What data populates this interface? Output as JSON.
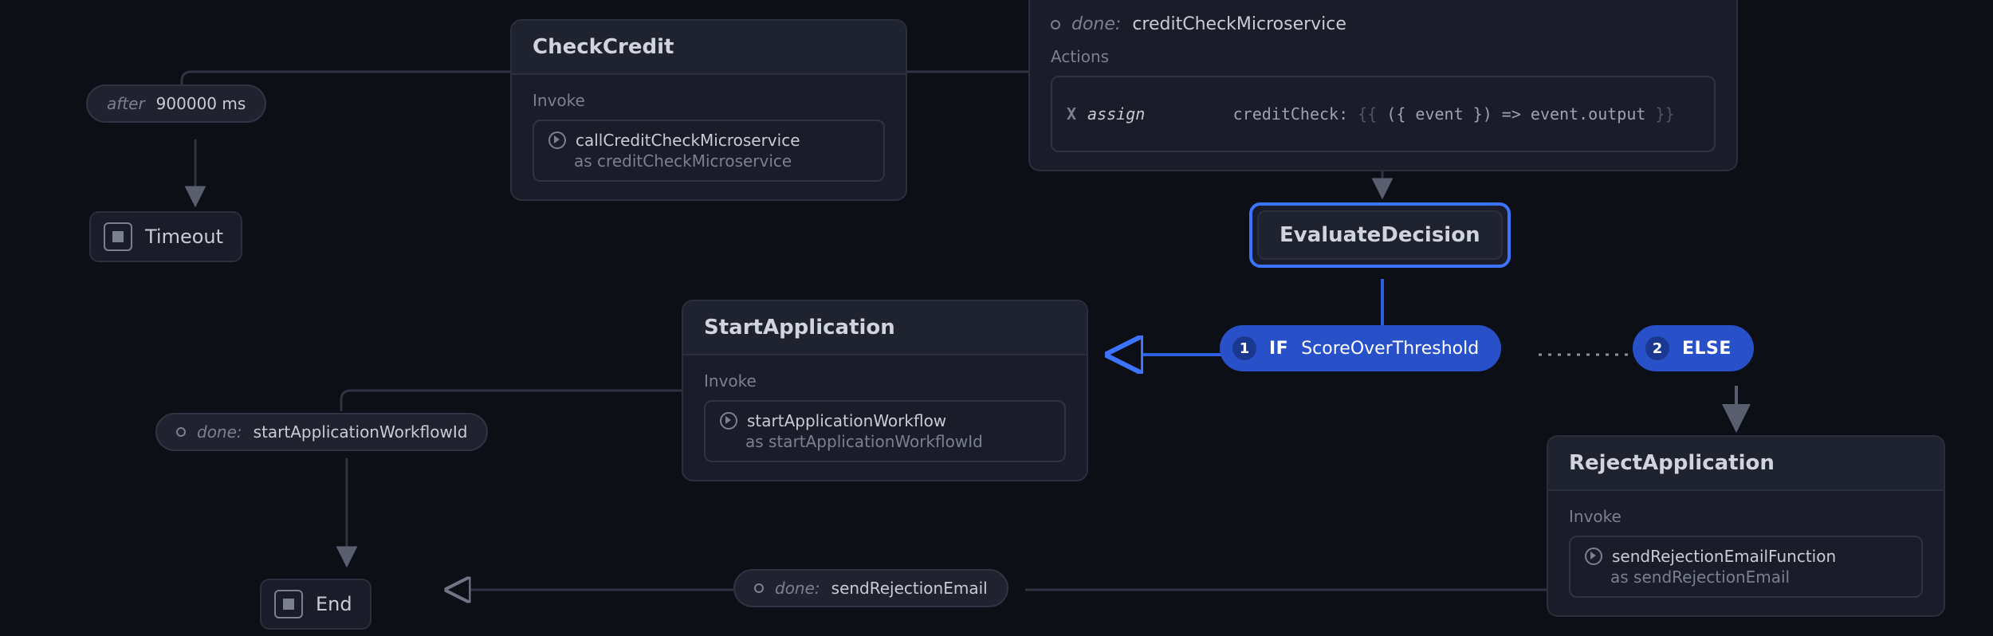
{
  "timeout_edge": {
    "keyword": "after",
    "value": "900000 ms"
  },
  "timeout_state": {
    "label": "Timeout"
  },
  "check_credit": {
    "title": "CheckCredit",
    "section": "Invoke",
    "invoke_fn": "callCreditCheckMicroservice",
    "invoke_as_prefix": "as ",
    "invoke_as": "creditCheckMicroservice"
  },
  "done_credit": {
    "keyword": "done:",
    "value": "creditCheckMicroservice",
    "actions_label": "Actions",
    "assign_x": "X",
    "assign_kw": "assign",
    "assign_code_open": "creditCheck: ",
    "assign_code_brace_l": "{{ ",
    "assign_code_body": "({ event }) => event.output",
    "assign_code_brace_r": " }}"
  },
  "evaluate": {
    "title": "EvaluateDecision"
  },
  "if_pill": {
    "num": "1",
    "kw": "IF",
    "cond": "ScoreOverThreshold"
  },
  "else_pill": {
    "num": "2",
    "kw": "ELSE"
  },
  "start_app": {
    "title": "StartApplication",
    "section": "Invoke",
    "invoke_fn": "startApplicationWorkflow",
    "invoke_as_prefix": "as ",
    "invoke_as": "startApplicationWorkflowId"
  },
  "done_start_app": {
    "keyword": "done:",
    "value": "startApplicationWorkflowId"
  },
  "reject_app": {
    "title": "RejectApplication",
    "section": "Invoke",
    "invoke_fn": "sendRejectionEmailFunction",
    "invoke_as_prefix": "as ",
    "invoke_as": "sendRejectionEmail"
  },
  "done_reject": {
    "keyword": "done:",
    "value": "sendRejectionEmail"
  },
  "end_state": {
    "label": "End"
  }
}
